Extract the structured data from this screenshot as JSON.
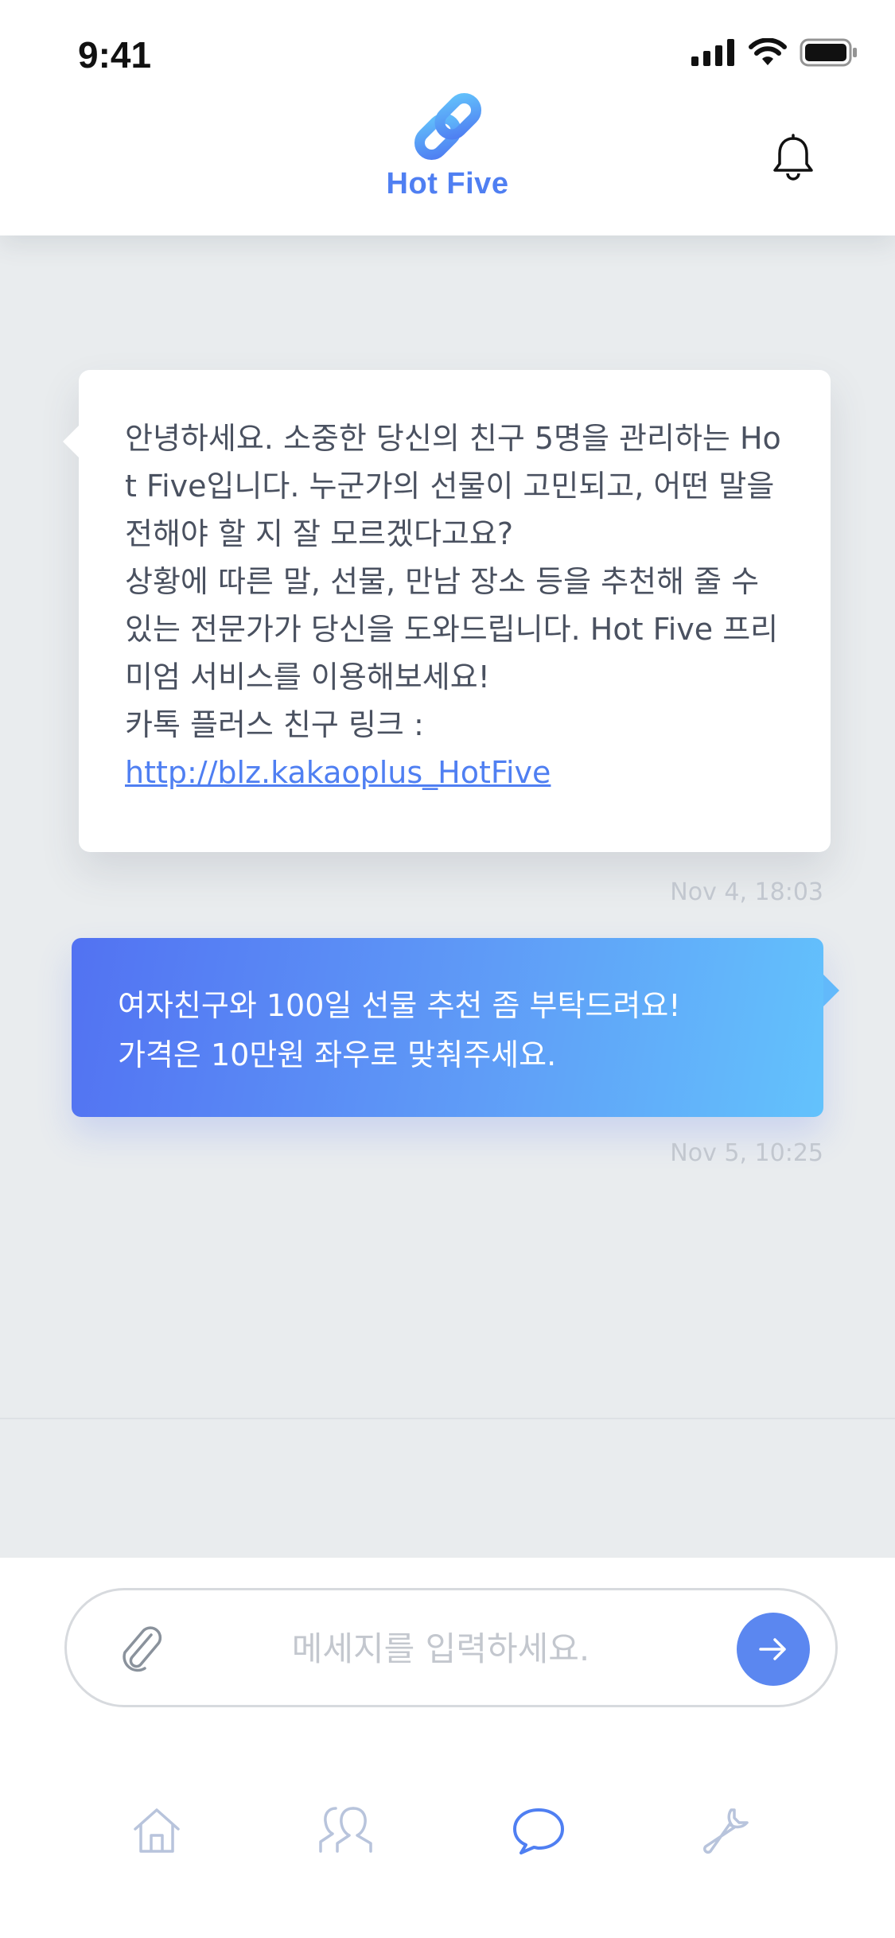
{
  "status": {
    "time": "9:41"
  },
  "header": {
    "app_name": "Hot Five",
    "bell_icon": "bell-icon",
    "accent_color": "#4f7ff2"
  },
  "messages": [
    {
      "direction": "incoming",
      "text": "안녕하세요. 소중한 당신의 친구 5명을 관리하는 Hot Five입니다. 누군가의 선물이 고민되고, 어떤 말을전해야 할 지 잘 모르겠다고요?\n상황에 따른 말, 선물, 만남 장소 등을 추천해 줄 수 있는 전문가가 당신을 도와드립니다. Hot Five 프리미엄 서비스를 이용해보세요!\n카톡 플러스 친구 링크 :",
      "link": "http://blz.kakaoplus_HotFive",
      "time": "Nov 4, 18:03"
    },
    {
      "direction": "outgoing",
      "text": "여자친구와 100일 선물 추천 좀 부탁드려요!\n가격은 10만원 좌우로 맞춰주세요.",
      "time": "Nov 5, 10:25"
    }
  ],
  "composer": {
    "placeholder": "메세지를 입력하세요.",
    "value": "",
    "attach_icon": "paperclip-icon",
    "send_icon": "arrow-right-icon",
    "send_color": "#5b87f0"
  },
  "tabbar": {
    "tabs": [
      {
        "icon": "home-icon",
        "active": false
      },
      {
        "icon": "people-icon",
        "active": false
      },
      {
        "icon": "chat-icon",
        "active": true
      },
      {
        "icon": "wrench-icon",
        "active": false
      }
    ],
    "active_color": "#4f7ff2",
    "inactive_color": "#b8c4dc"
  }
}
